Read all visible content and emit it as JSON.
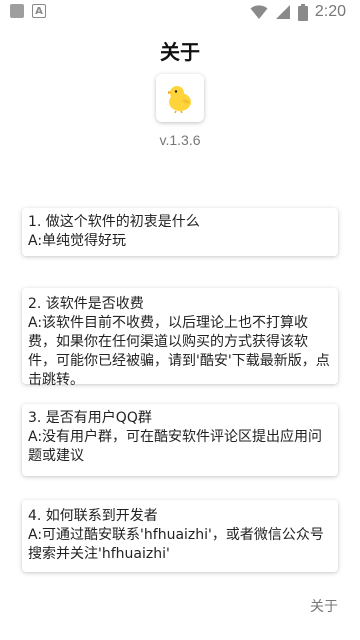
{
  "status_bar": {
    "time": "2:20",
    "left_icons": [
      "notification-square-icon",
      "a-icon"
    ],
    "right_icons": [
      "wifi-icon",
      "cellular-signal-icon",
      "battery-icon"
    ]
  },
  "header": {
    "title": "关于"
  },
  "app": {
    "icon": "chick-logo",
    "version": "v.1.3.6"
  },
  "faq": [
    {
      "question": "1. 做这个软件的初衷是什么",
      "answer": "A:单纯觉得好玩"
    },
    {
      "question": "2. 该软件是否收费",
      "answer": "A:该软件目前不收费，以后理论上也不打算收费，如果你在任何渠道以购买的方式获得该软件，可能你已经被骗，请到'酷安'下载最新版，点击跳转。"
    },
    {
      "question": "3. 是否有用户QQ群",
      "answer": "A:没有用户群，可在酷安软件评论区提出应用问题或建议"
    },
    {
      "question": "4. 如何联系到开发者",
      "answer": "A:可通过酷安联系'hfhuaizhi'，或者微信公众号搜索并关注'hfhuaizhi'"
    }
  ],
  "footer": {
    "about_label": "关于"
  },
  "colors": {
    "accent_yellow": "#FFD43B",
    "text_gray": "#777777"
  }
}
